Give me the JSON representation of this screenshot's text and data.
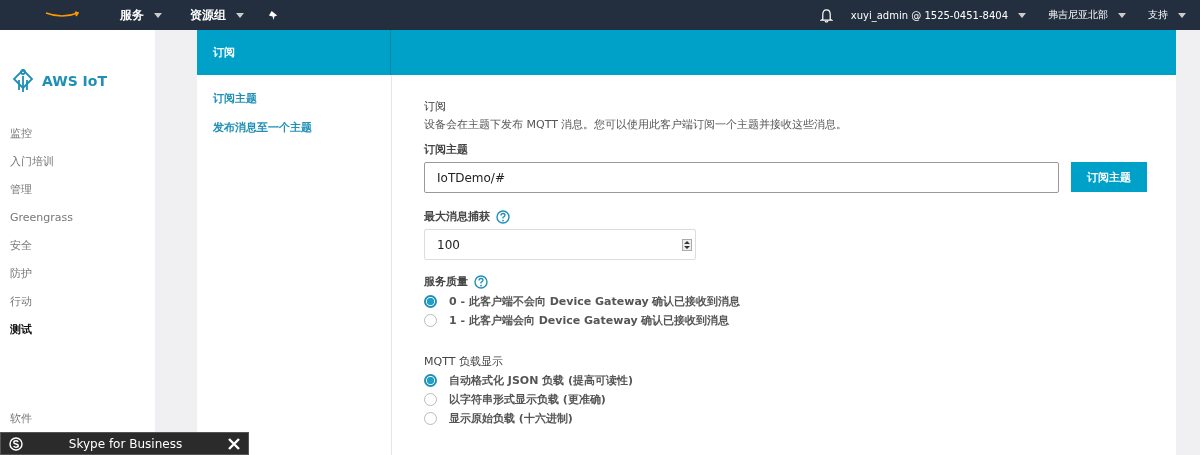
{
  "top_bar": {
    "menus": [
      {
        "label": "服务"
      },
      {
        "label": "资源组"
      }
    ],
    "account": "xuyi_admin @ 1525-0451-8404",
    "region": "弗吉尼亚北部",
    "support": "支持"
  },
  "sidebar": {
    "brand": "AWS IoT",
    "items": [
      {
        "label": "监控",
        "selected": false
      },
      {
        "label": "入门培训",
        "selected": false
      },
      {
        "label": "管理",
        "selected": false
      },
      {
        "label": "Greengrass",
        "selected": false
      },
      {
        "label": "安全",
        "selected": false
      },
      {
        "label": "防护",
        "selected": false
      },
      {
        "label": "行动",
        "selected": false
      },
      {
        "label": "测试",
        "selected": true
      }
    ],
    "bottom_item": "软件"
  },
  "subnav": {
    "title": "订阅",
    "links": [
      "订阅主题",
      "发布消息至一个主题"
    ]
  },
  "form": {
    "heading": "订阅",
    "description": "设备会在主题下发布 MQTT 消息。您可以使用此客户端订阅一个主题并接收这些消息。",
    "topic_label": "订阅主题",
    "topic_value": "IoTDemo/#",
    "subscribe_button": "订阅主题",
    "max_label": "最大消息捕获",
    "max_value": "100",
    "qos_label": "服务质量",
    "qos_options": [
      {
        "label": "0 - 此客户端不会向 Device Gateway 确认已接收到消息",
        "selected": true
      },
      {
        "label": "1 - 此客户端会向 Device Gateway 确认已接收到消息",
        "selected": false
      }
    ],
    "payload_label": "MQTT 负载显示",
    "payload_options": [
      {
        "label": "自动格式化 JSON 负载 (提高可读性)",
        "selected": true
      },
      {
        "label": "以字符串形式显示负载 (更准确)",
        "selected": false
      },
      {
        "label": "显示原始负载 (十六进制)",
        "selected": false
      }
    ]
  },
  "skype_bar": {
    "title": "Skype for Business"
  }
}
